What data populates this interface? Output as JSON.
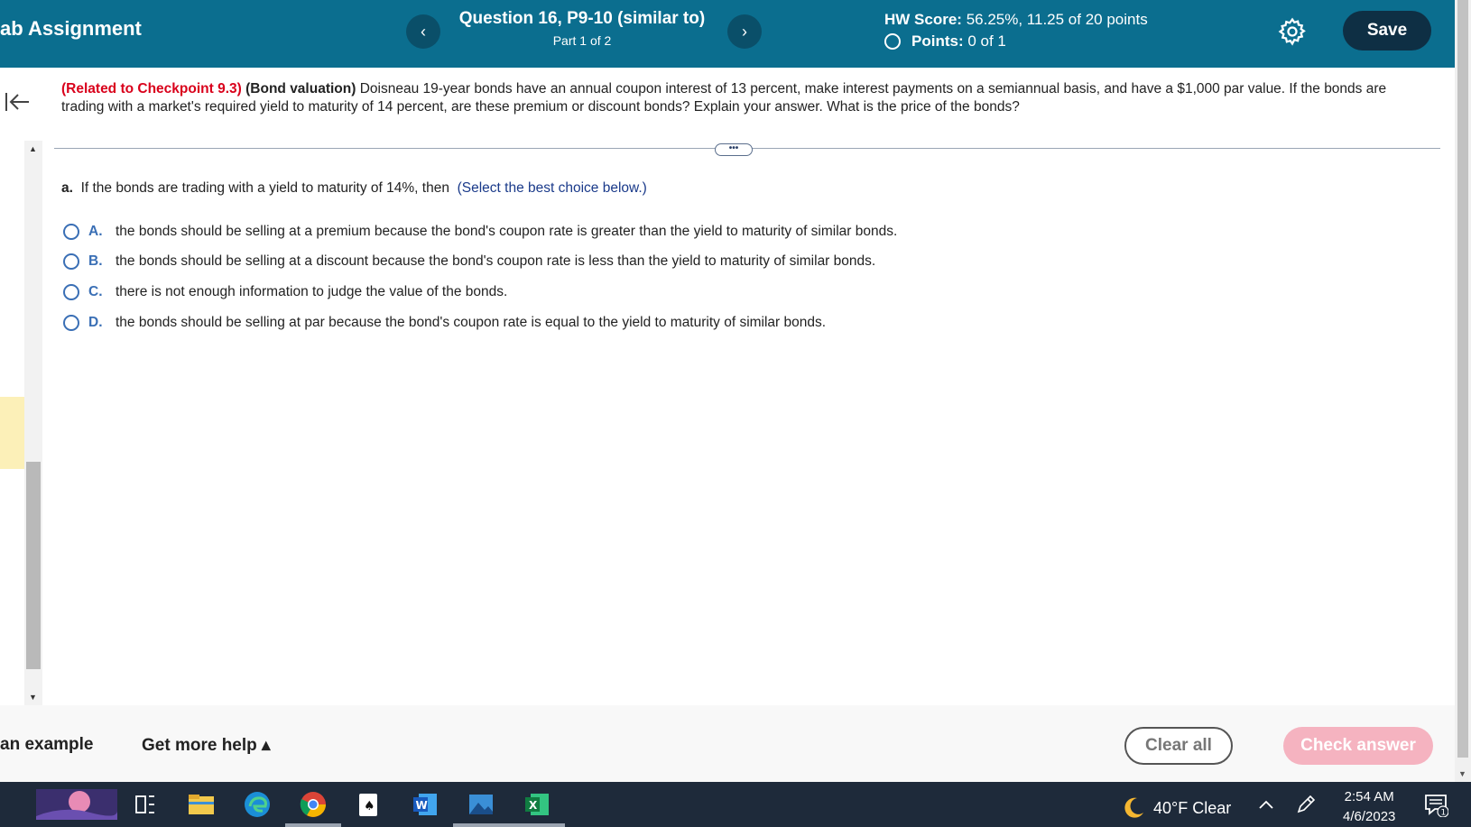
{
  "header": {
    "app_title": "ab Assignment",
    "question_title": "Question 16, P9-10 (similar to)",
    "part": "Part 1 of 2",
    "hw_score_label": "HW Score:",
    "hw_score_value": "56.25%, 11.25 of 20 points",
    "points_label": "Points:",
    "points_value": "0 of 1",
    "prev_glyph": "‹",
    "next_glyph": "›",
    "save_label": "Save"
  },
  "question": {
    "related": "(Related to Checkpoint 9.3)",
    "topic": "(Bond valuation)",
    "text": "Doisneau 19-year bonds have an annual coupon interest of 13 percent, make interest payments on a semiannual basis, and have a $1,000 par value.  If the bonds are trading with a market's required yield to maturity of 14 percent, are these premium or discount bonds?  Explain your answer.  What is the price of the bonds?"
  },
  "more_glyph": "•••",
  "part_a": {
    "label": "a.",
    "prompt": "If the bonds are trading with a yield to maturity of 14%, then",
    "hint": "(Select the best choice below.)"
  },
  "choices": [
    {
      "letter": "A.",
      "text": "the bonds should be selling at a premium because the bond's coupon rate is greater than the yield to maturity of similar bonds."
    },
    {
      "letter": "B.",
      "text": "the bonds should be selling at a discount because the bond's coupon rate is less than the yield to maturity of similar bonds."
    },
    {
      "letter": "C.",
      "text": "there is not enough information to judge the value of the bonds."
    },
    {
      "letter": "D.",
      "text": "the bonds should be selling at par because the bond's coupon rate is equal to the yield to maturity of similar bonds."
    }
  ],
  "footer": {
    "see_example": "an example",
    "get_help": "Get more help ▴",
    "clear_all": "Clear all",
    "check_answer": "Check answer"
  },
  "taskbar": {
    "weather": "40°F  Clear",
    "time": "2:54 AM",
    "date": "4/6/2023",
    "notification_count": "1",
    "icons": [
      "widgets-icon",
      "task-view-icon",
      "file-explorer-icon",
      "edge-icon",
      "chrome-icon",
      "solitaire-icon",
      "word-icon",
      "photos-icon",
      "excel-icon"
    ]
  },
  "colors": {
    "header_bg": "#0b6e8f",
    "save_bg": "#0e2f44",
    "related_red": "#d9001b",
    "choice_blue": "#3a6fb5",
    "check_answer_bg": "#f5b3c0"
  }
}
